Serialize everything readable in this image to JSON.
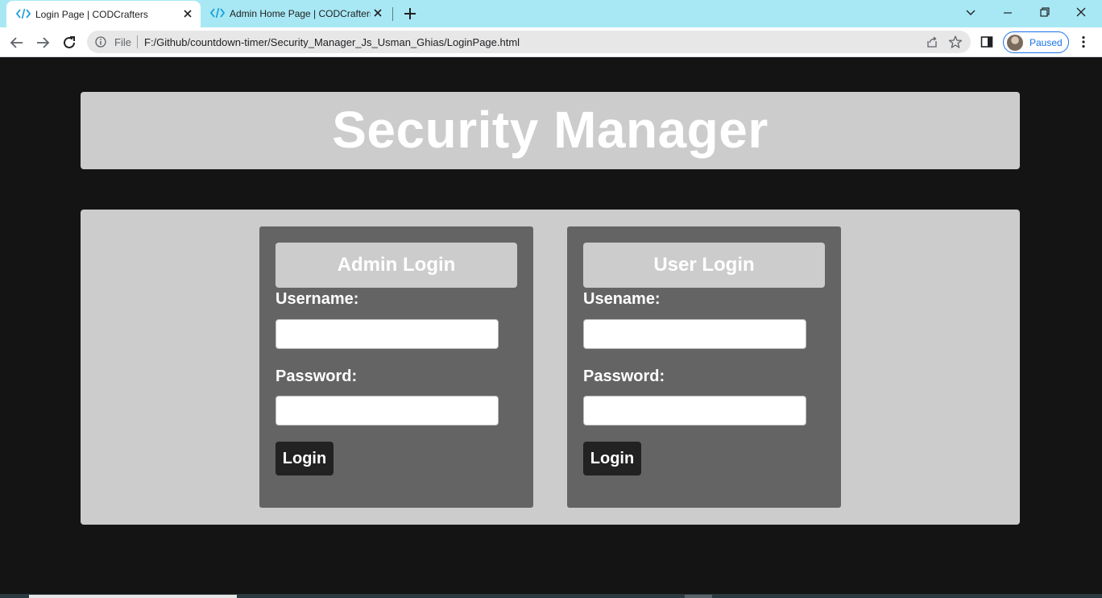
{
  "browser": {
    "tabs": [
      {
        "title": "Login Page | CODCrafters",
        "active": true
      },
      {
        "title": "Admin Home Page | CODCrafters",
        "active": false
      }
    ],
    "address": {
      "scheme_label": "File",
      "url": "F:/Github/countdown-timer/Security_Manager_Js_Usman_Ghias/LoginPage.html"
    },
    "profile_label": "Paused",
    "colors": {
      "tabstrip": "#a8e8f4",
      "accent": "#1a73e8",
      "favicon": "#1a9fd9"
    }
  },
  "page": {
    "title": "Security Manager",
    "admin": {
      "heading": "Admin Login",
      "username_label": "Username:",
      "password_label": "Password:",
      "username_value": "",
      "password_value": "",
      "button_label": "Login"
    },
    "user": {
      "heading": "User Login",
      "username_label": "Usename:",
      "password_label": "Password:",
      "username_value": "",
      "password_value": "",
      "button_label": "Login"
    },
    "colors": {
      "background": "#141414",
      "panel": "#cccccc",
      "card": "#646464",
      "button": "#222222"
    }
  }
}
